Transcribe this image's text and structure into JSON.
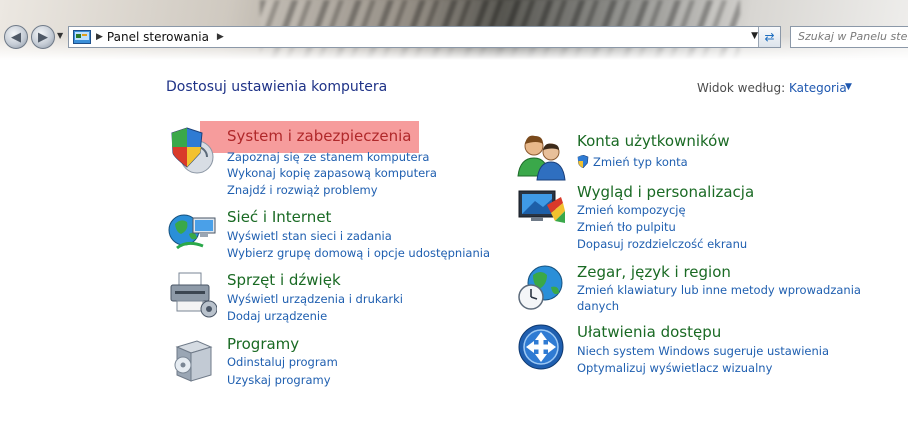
{
  "address_bar": {
    "breadcrumb": "Panel sterowania",
    "search_placeholder": "Szukaj w Panelu sterowania"
  },
  "header": {
    "title": "Dostosuj ustawienia komputera",
    "view_label": "Widok według:",
    "view_value": "Kategoria"
  },
  "left_column": [
    {
      "title": "System i zabezpieczenia",
      "links": [
        "Zapoznaj się ze stanem komputera",
        "Wykonaj kopię zapasową komputera",
        "Znajdź i rozwiąż problemy"
      ]
    },
    {
      "title": "Sieć i Internet",
      "links": [
        "Wyświetl stan sieci i zadania",
        "Wybierz grupę domową i opcje udostępniania"
      ]
    },
    {
      "title": "Sprzęt i dźwięk",
      "links": [
        "Wyświetl urządzenia i drukarki",
        "Dodaj urządzenie"
      ]
    },
    {
      "title": "Programy",
      "links": [
        "Odinstaluj program",
        "Uzyskaj programy"
      ]
    }
  ],
  "right_column": [
    {
      "title": "Konta użytkowników",
      "links": [
        "Zmień typ konta"
      ]
    },
    {
      "title": "Wygląd i personalizacja",
      "links": [
        "Zmień kompozycję",
        "Zmień tło pulpitu",
        "Dopasuj rozdzielczość ekranu"
      ]
    },
    {
      "title": "Zegar, język i region",
      "links": [
        "Zmień klawiatury lub inne metody wprowadzania",
        "danych"
      ]
    },
    {
      "title": "Ułatwienia dostępu",
      "links": [
        "Niech system Windows sugeruje ustawienia",
        "Optymalizuj wyświetlacz wizualny"
      ]
    }
  ],
  "highlight": {
    "target": "System i zabezpieczenia",
    "color": "#f06060"
  },
  "colors": {
    "heading": "#1a6a24",
    "link": "#1f5fb0",
    "title": "#1e3287"
  }
}
